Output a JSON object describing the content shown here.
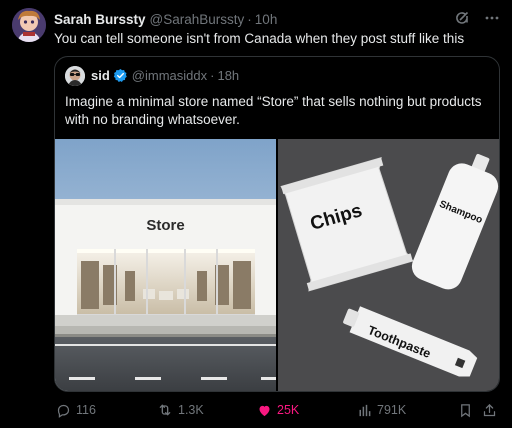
{
  "tweet": {
    "author_name": "Sarah Burssty",
    "author_handle": "@SarahBurssty",
    "separator": "·",
    "time": "10h",
    "text": "You can tell someone isn't from Canada when they post stuff like this"
  },
  "quoted_tweet": {
    "author_name": "sid",
    "author_handle": "@immasiddx",
    "separator": "·",
    "time": "18h",
    "text": "Imagine a minimal store named “Store” that sells nothing but products with no branding whatsoever.",
    "media": {
      "store_sign": "Store",
      "products": {
        "chips_label": "Chips",
        "shampoo_label": "Shampoo",
        "toothpaste_label": "Toothpaste"
      }
    }
  },
  "actions": {
    "replies": "116",
    "reposts": "1.3K",
    "likes": "25K",
    "views": "791K"
  },
  "colors": {
    "background": "#000000",
    "text_primary": "#e7e9ea",
    "text_secondary": "#71767b",
    "border": "#2f3336",
    "verified": "#1d9bf0",
    "like_active": "#f91880"
  },
  "icons": [
    "grok-icon",
    "more-icon",
    "verified-badge-icon",
    "reply-icon",
    "repost-icon",
    "like-icon",
    "views-icon",
    "bookmark-icon",
    "share-icon"
  ]
}
